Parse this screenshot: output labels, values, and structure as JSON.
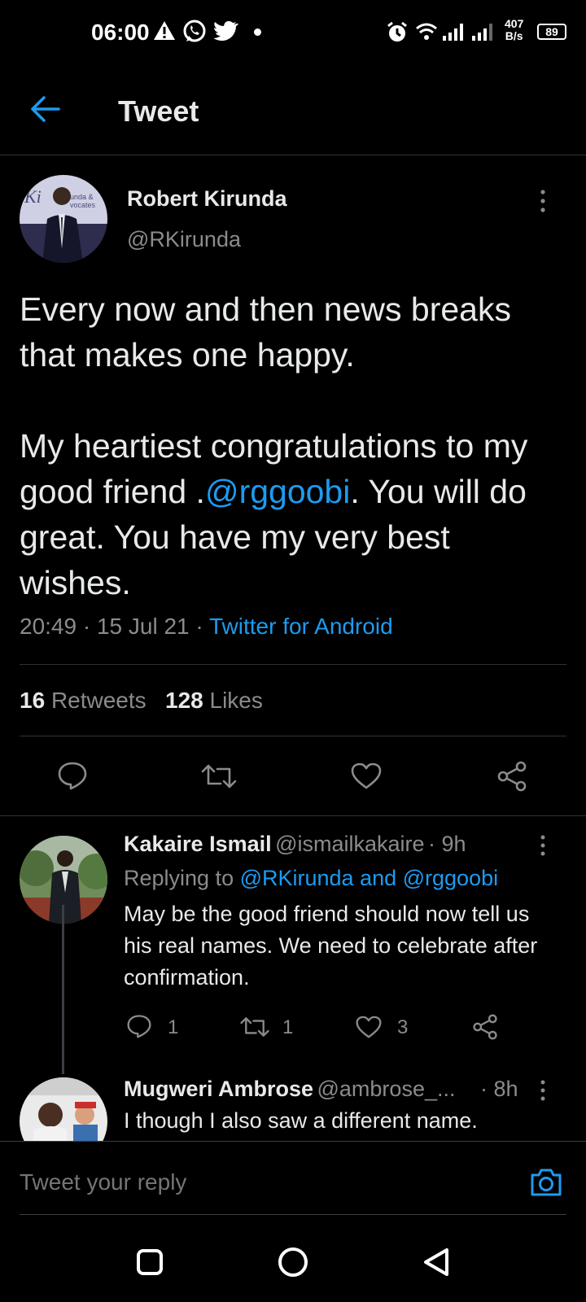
{
  "status_bar": {
    "time": "06:00",
    "net_speed_value": "407",
    "net_speed_unit": "B/s",
    "battery": "89"
  },
  "header": {
    "title": "Tweet",
    "back_icon": "arrow-left-icon"
  },
  "tweet": {
    "author_name": "Robert Kirunda",
    "author_handle": "@RKirunda",
    "text_line1": "Every now and then news breaks that makes one happy.",
    "text_para2_before": "My heartiest congratulations to my good friend .",
    "text_mention": "@rggoobi",
    "text_para2_after": ". You will do great. You have my very best wishes.",
    "time": "20:49",
    "date": "15 Jul 21",
    "source": "Twitter for Android",
    "retweets_count": "16",
    "retweets_label": "Retweets",
    "likes_count": "128",
    "likes_label": "Likes"
  },
  "replies": [
    {
      "name": "Kakaire Ismail",
      "handle": "@ismailkakaire",
      "age": "· 9h",
      "replying_prefix": "Replying to ",
      "replying_to": "@RKirunda and @rggoobi",
      "text": "May be the good friend should now tell us his real names. We need to celebrate after confirmation.",
      "reply_count": "1",
      "retweet_count": "1",
      "like_count": "3"
    },
    {
      "name": "Mugweri Ambrose",
      "handle": "@ambrose_...",
      "age": "· 8h",
      "text": "I though I also saw a different name."
    }
  ],
  "reply_input": {
    "placeholder": "Tweet your reply"
  },
  "colors": {
    "accent": "#1d9bf0",
    "background": "#000000",
    "secondary_text": "#8b8b8b"
  }
}
